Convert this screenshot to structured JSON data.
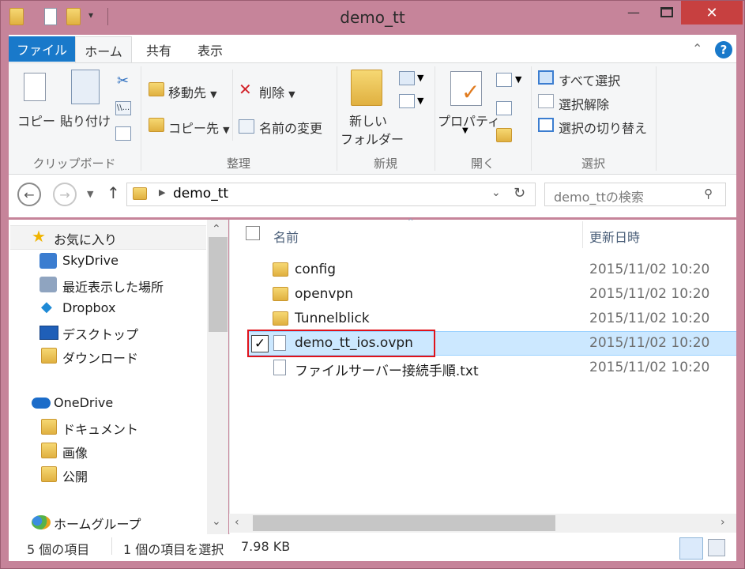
{
  "window": {
    "title": "demo_tt"
  },
  "ribbon_tabs": [
    "ファイル",
    "ホーム",
    "共有",
    "表示"
  ],
  "ribbon": {
    "clipboard": {
      "copy": "コピー",
      "paste": "貼り付け",
      "label": "クリップボード"
    },
    "organize": {
      "move_to": "移動先",
      "copy_to": "コピー先",
      "delete": "削除",
      "rename": "名前の変更",
      "label": "整理"
    },
    "new": {
      "new_folder_line1": "新しい",
      "new_folder_line2": "フォルダー",
      "label": "新規"
    },
    "open": {
      "properties": "プロパティ",
      "label": "開く"
    },
    "select": {
      "select_all": "すべて選択",
      "select_none": "選択解除",
      "invert": "選択の切り替え",
      "label": "選択"
    }
  },
  "address": {
    "path": "demo_tt",
    "search_placeholder": "demo_ttの検索"
  },
  "nav": {
    "favorites": "お気に入り",
    "fav_items": [
      "SkyDrive",
      "最近表示した場所",
      "Dropbox",
      "デスクトップ",
      "ダウンロード"
    ],
    "onedrive": "OneDrive",
    "onedrive_items": [
      "ドキュメント",
      "画像",
      "公開"
    ],
    "homegroup": "ホームグループ"
  },
  "columns": {
    "name": "名前",
    "date": "更新日時"
  },
  "files": [
    {
      "name": "config",
      "date": "2015/11/02 10:20",
      "type": "folder"
    },
    {
      "name": "openvpn",
      "date": "2015/11/02 10:20",
      "type": "folder"
    },
    {
      "name": "Tunnelblick",
      "date": "2015/11/02 10:20",
      "type": "folder"
    },
    {
      "name": "demo_tt_ios.ovpn",
      "date": "2015/11/02 10:20",
      "type": "file",
      "selected": true
    },
    {
      "name": "ファイルサーバー接続手順.txt",
      "date": "2015/11/02 10:20",
      "type": "text"
    }
  ],
  "status": {
    "count": "5 個の項目",
    "selection": "1 個の項目を選択",
    "size": "7.98 KB"
  },
  "colors": {
    "accent": "#1979ca",
    "frame": "#c6849a",
    "close": "#c74040",
    "selected": "#cce8ff",
    "highlight_border": "#e0131b"
  }
}
